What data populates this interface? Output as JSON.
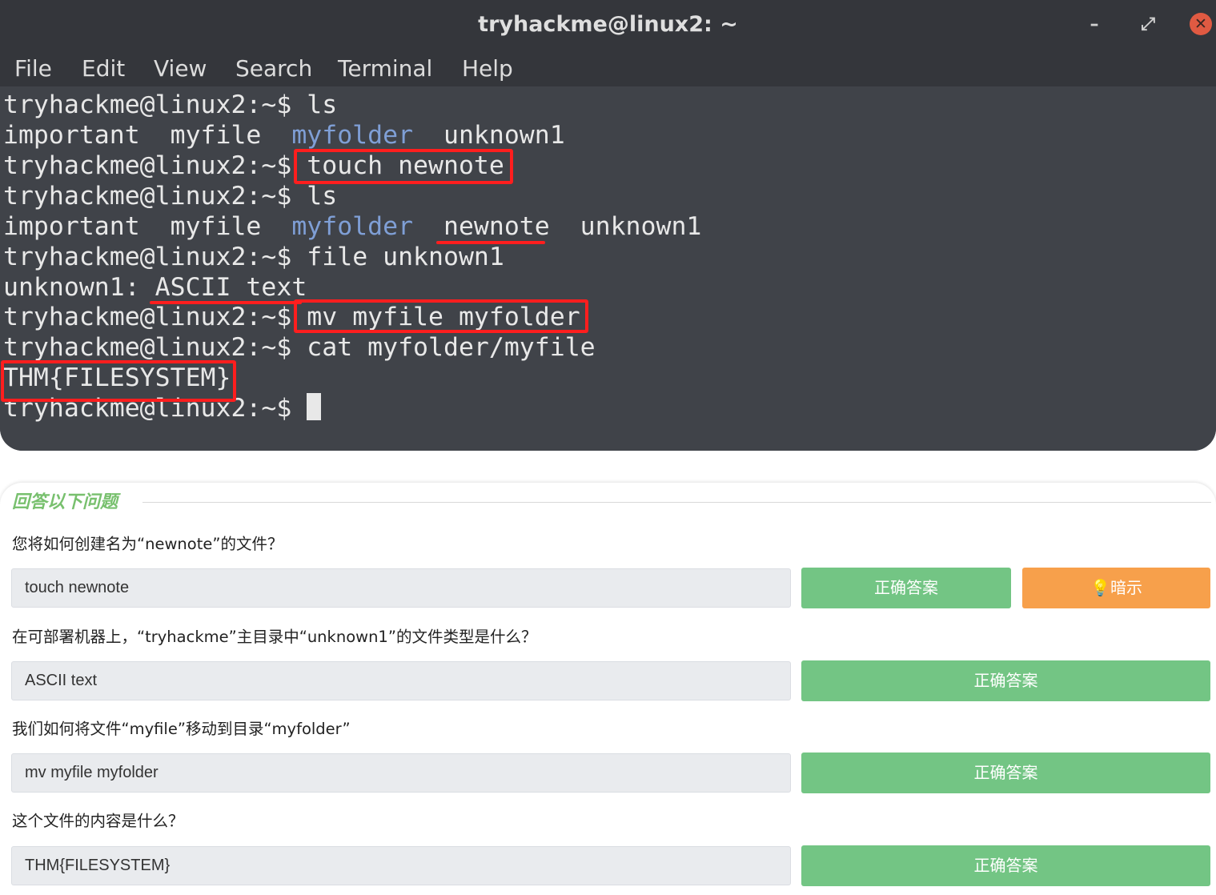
{
  "window": {
    "title": "tryhackme@linux2: ~",
    "minimize": "–",
    "maximize": "⤢",
    "close": "✕"
  },
  "menu": [
    "File",
    "Edit",
    "View",
    "Search",
    "Terminal",
    "Help"
  ],
  "terminal": {
    "prompt": "tryhackme@linux2:~$ ",
    "lines": {
      "l1_cmd": "ls",
      "l2_a": "important  myfile  ",
      "l2_dir": "myfolder",
      "l2_b": "  unknown1",
      "l3_cmd": "touch newnote",
      "l4_cmd": "ls",
      "l5_a": "important  myfile  ",
      "l5_dir": "myfolder",
      "l5_b": "  newnote  unknown1",
      "l6_cmd": "file unknown1",
      "l7": "unknown1: ASCII text",
      "l8_cmd": "mv myfile myfolder",
      "l9_cmd": "cat myfolder/myfile",
      "l10": "THM{FILESYSTEM}"
    }
  },
  "questions": {
    "heading": "回答以下问题",
    "items": [
      {
        "question": "您将如何创建名为“newnote”的文件？",
        "answer": "touch newnote",
        "button": "正确答案",
        "hint": "💡暗示"
      },
      {
        "question": "在可部署机器上，“tryhackme”主目录中“unknown1”的文件类型是什么？",
        "answer": "ASCII text",
        "button": "正确答案"
      },
      {
        "question": "我们如何将文件“myfile”移动到目录“myfolder”",
        "answer": "mv myfile myfolder",
        "button": "正确答案"
      },
      {
        "question": "这个文件的内容是什么？",
        "answer": "THM{FILESYSTEM}",
        "button": "正确答案"
      }
    ]
  },
  "colors": {
    "annotation_red": "#ff1e1e",
    "correct_green": "#73c584",
    "hint_orange": "#f7a04b",
    "terminal_bg": "#404349",
    "directory_blue": "#7f9fd6"
  }
}
